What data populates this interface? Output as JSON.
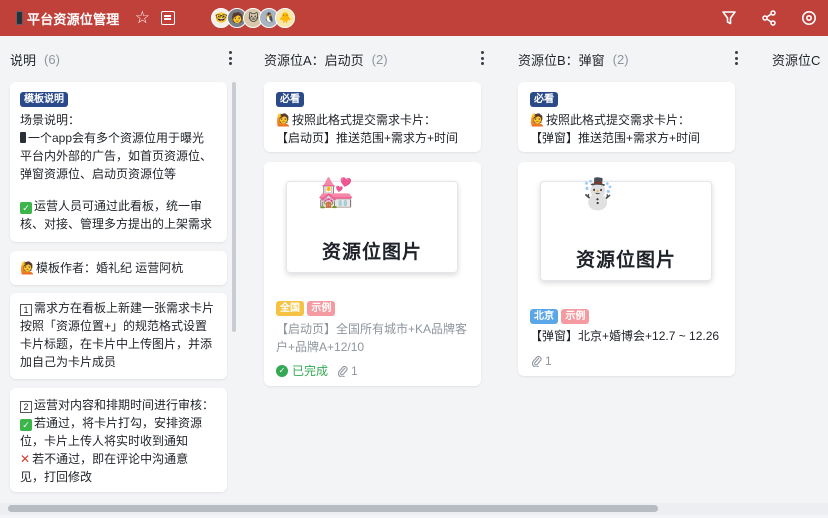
{
  "header": {
    "title": "平台资源位管理",
    "avatars": [
      "🤓",
      "🧑",
      "🐱",
      "🐧",
      "🐥"
    ]
  },
  "columns": [
    {
      "title": "说明",
      "count": "(6)"
    },
    {
      "title": "资源位A：启动页",
      "count": "(2)"
    },
    {
      "title": "资源位B：弹窗",
      "count": "(2)"
    },
    {
      "title": "资源位C"
    }
  ],
  "col1": {
    "card1": {
      "tag": "模板说明",
      "l1": "场景说明：",
      "l2": "一个app会有多个资源位用于曝光",
      "l3": "平台内外部的广告，如首页资源位、",
      "l4": "弹窗资源位、启动页资源位等",
      "l5": "运营人员可通过此看板，统一审",
      "l6": "核、对接、管理多方提出的上架需求"
    },
    "card2": {
      "text": "模板作者：婚礼纪 运营阿杭"
    },
    "card3": {
      "l1": "需求方在看板上新建一张需求卡片",
      "l2": "按照「资源位置+」的规范格式设置",
      "l3": "卡片标题，在卡片中上传图片，并添",
      "l4": "加自己为卡片成员"
    },
    "card4": {
      "l1": "运营对内容和排期时间进行审核：",
      "l2": "若通过，将卡片打勾，安排资源",
      "l3": "位，卡片上传人将实时收到通知",
      "l4": "若不通过，即在评论中沟通意",
      "l5": "见，打回修改"
    }
  },
  "col2": {
    "card1": {
      "tag": "必看",
      "l1": "按照此格式提交需求卡片：",
      "l2": "【启动页】推送范围+需求方+时间"
    },
    "card2": {
      "img_text": "资源位图片",
      "tag1": "全国",
      "tag2": "示例",
      "l1": "【启动页】全国所有城市+KA品牌客",
      "l2": "户+品牌A+12/10",
      "status": "已完成",
      "attachments": "1"
    }
  },
  "col3": {
    "card1": {
      "tag": "必看",
      "l1": "按照此格式提交需求卡片：",
      "l2": "【弹窗】推送范围+需求方+时间"
    },
    "card2": {
      "img_text": "资源位图片",
      "tag1": "北京",
      "tag2": "示例",
      "l1": "【弹窗】北京+婚博会+12.7 ~ 12.26",
      "attachments": "1"
    }
  },
  "colors": {
    "header": "#c0403a",
    "done": "#34a853",
    "tag_blue": "#2a4a8a"
  },
  "icons": [
    "star-icon",
    "description-icon",
    "filter-icon",
    "share-icon",
    "settings-icon",
    "more-icon",
    "paperclip-icon",
    "check-icon"
  ]
}
